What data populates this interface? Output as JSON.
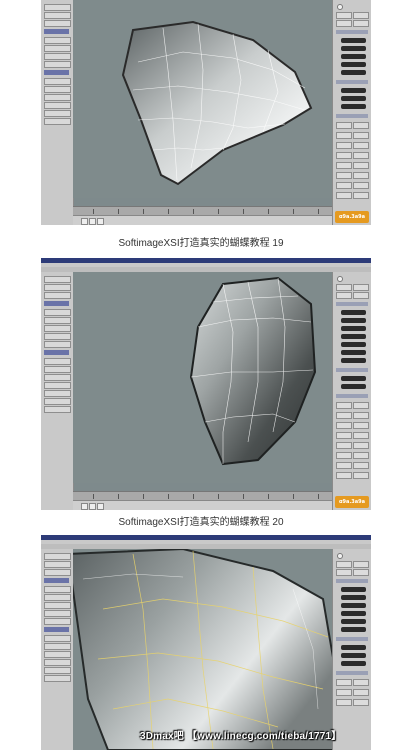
{
  "panels": [
    {
      "caption": "SoftimageXSI打造真实的蝴蝶教程 19",
      "logo": "ɑ9a.3a9a"
    },
    {
      "caption": "SoftimageXSI打造真实的蝴蝶教程 20",
      "logo": "ɑ9a.3a9a"
    },
    {
      "caption": ""
    }
  ],
  "watermark": "3Dmax吧 【www.linecg.com/tieba/1771】",
  "colors": {
    "viewport_bg": "#7e8a8c",
    "title_bar": "#2d3b78",
    "panel_bg": "#c9c9c9",
    "wire": "#ffffff",
    "selected_wire": "#e8d36a",
    "logo_bg": "#e59a20"
  },
  "icons": [
    "camera-icon",
    "play-icon",
    "object-icon"
  ]
}
